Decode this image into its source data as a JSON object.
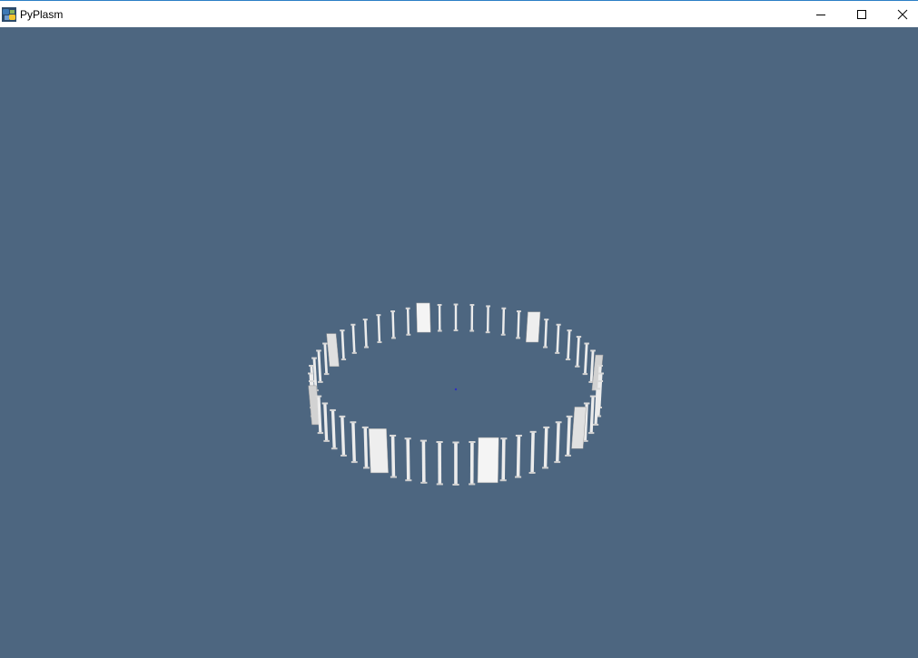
{
  "window": {
    "title": "PyPlasm",
    "accent_color": "#2c7fc6",
    "icon": "python-icon"
  },
  "caption_buttons": {
    "minimize": "minimize-icon",
    "maximize": "maximize-icon",
    "close": "close-icon"
  },
  "viewport": {
    "background_color": "#4d6680",
    "model_color": "#e6e6e6",
    "scene": "3d-circular-colonnade"
  }
}
